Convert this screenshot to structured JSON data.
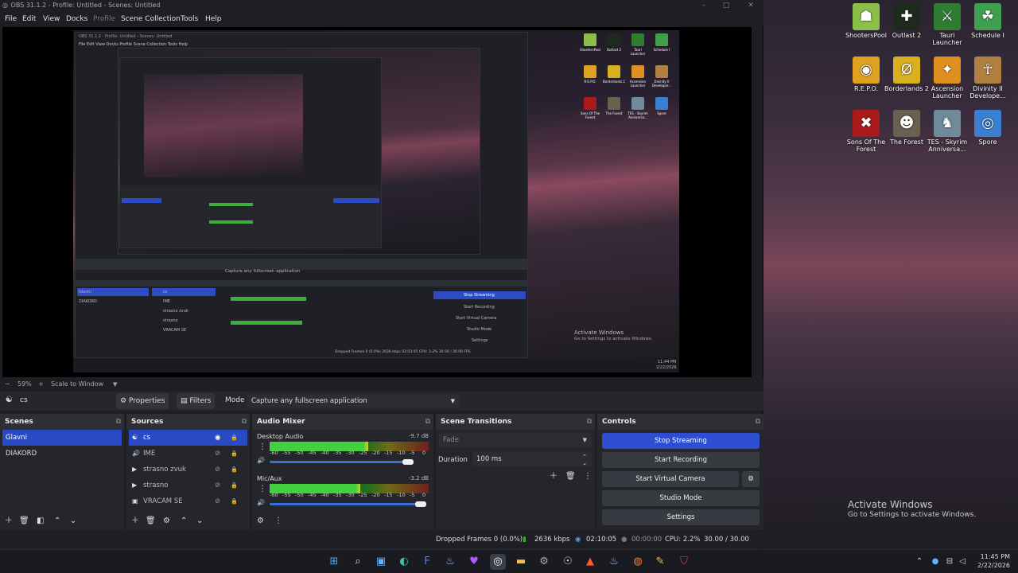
{
  "window": {
    "title": "OBS 31.1.2 - Profile: Untitled - Scenes: Untitled",
    "minimize": "–",
    "maximize": "□",
    "close": "✕"
  },
  "menu": {
    "items": [
      {
        "label": "File",
        "disabled": false
      },
      {
        "label": "Edit",
        "disabled": false
      },
      {
        "label": "View",
        "disabled": false
      },
      {
        "label": "Docks",
        "disabled": false
      },
      {
        "label": "Profile",
        "disabled": true
      },
      {
        "label": "Scene Collection",
        "disabled": false
      },
      {
        "label": "Tools",
        "disabled": false
      },
      {
        "label": "Help",
        "disabled": false
      }
    ]
  },
  "preview": {
    "nested_title": "OBS 31.1.2 - Profile: Untitled - Scenes: Untitled",
    "nested_menu": "File  Edit  View  Docks  Profile  Scene Collection  Tools  Help",
    "nested_scenes": [
      "Glavni",
      "DIAKORD"
    ],
    "nested_sources": [
      "cs",
      "IME",
      "strasno zvuk",
      "strasno",
      "VRACAM SE"
    ],
    "nested_mode": "Capture any fullscreen application",
    "nested_controls": [
      "Stop Streaming",
      "Start Recording",
      "Start Virtual Camera",
      "Studio Mode",
      "Settings"
    ],
    "nested_status": "Dropped Frames 0 (0.0%)   2636 kbps   02:03:05   CPU: 3.2%  30.00 / 30.00 FPS",
    "nested_desktop_icons": [
      "ShootersPool",
      "Outlast 2",
      "Tauri Launcher",
      "Schedule I",
      "R.E.P.O.",
      "Borderlands 2",
      "Ascension Launcher",
      "Divinity II Developer...",
      "Sons Of The Forest",
      "The Forest",
      "TES - Skyrim Anniversa...",
      "Spore"
    ],
    "nested_watermark_title": "Activate Windows",
    "nested_watermark_sub": "Go to Settings to activate Windows.",
    "nested_clock_time": "11:44 PM",
    "nested_clock_date": "2/22/2026"
  },
  "zoom": {
    "value": "59%",
    "mode": "Scale to Window",
    "minus": "−",
    "plus": "+"
  },
  "context": {
    "source": "cs",
    "properties": "Properties",
    "filters": "Filters",
    "mode_label": "Mode",
    "mode_value": "Capture any fullscreen application"
  },
  "scenes": {
    "title": "Scenes",
    "items": [
      {
        "label": "Glavni",
        "selected": true
      },
      {
        "label": "DIAKORD",
        "selected": false
      }
    ]
  },
  "sources": {
    "title": "Sources",
    "items": [
      {
        "label": "cs",
        "selected": true,
        "icon": "game-icon"
      },
      {
        "label": "IME",
        "selected": false,
        "icon": "audio-icon"
      },
      {
        "label": "strasno zvuk",
        "selected": false,
        "icon": "play-icon"
      },
      {
        "label": "strasno",
        "selected": false,
        "icon": "play-icon"
      },
      {
        "label": "VRACAM SE",
        "selected": false,
        "icon": "image-icon"
      }
    ]
  },
  "mixer": {
    "title": "Audio Mixer",
    "channels": [
      {
        "name": "Desktop Audio",
        "db": "-9.7 dB",
        "level": 0.62,
        "volume": 0.87
      },
      {
        "name": "Mic/Aux",
        "db": "-3.2 dB",
        "level": 0.57,
        "volume": 0.95
      }
    ],
    "scale": [
      "-60",
      "-55",
      "-50",
      "-45",
      "-40",
      "-35",
      "-30",
      "-25",
      "-20",
      "-15",
      "-10",
      "-5",
      "0"
    ]
  },
  "transitions": {
    "title": "Scene Transitions",
    "type": "Fade",
    "duration_label": "Duration",
    "duration_value": "100 ms"
  },
  "controls": {
    "title": "Controls",
    "buttons": [
      {
        "label": "Stop Streaming",
        "active": true
      },
      {
        "label": "Start Recording",
        "active": false
      },
      {
        "label": "Start Virtual Camera",
        "active": false
      },
      {
        "label": "Studio Mode",
        "active": false
      },
      {
        "label": "Settings",
        "active": false
      }
    ]
  },
  "status": {
    "dropped": "Dropped Frames 0 (0.0%)",
    "bitrate": "2636 kbps",
    "stream_time": "02:10:05",
    "rec_time": "00:00:00",
    "cpu": "CPU: 2.2%",
    "fps": "30.00 / 30.00 FPS"
  },
  "desktop": {
    "icons": [
      {
        "label": "ShootersPool",
        "color": "#8ac048",
        "glyph": "☗"
      },
      {
        "label": "Outlast 2",
        "color": "#1d2a1d",
        "glyph": "✚"
      },
      {
        "label": "Tauri Launcher",
        "color": "#2e7d32",
        "glyph": "⚔"
      },
      {
        "label": "Schedule I",
        "color": "#3f9f4f",
        "glyph": "☘"
      },
      {
        "label": "R.E.P.O.",
        "color": "#e0a020",
        "glyph": "◉"
      },
      {
        "label": "Borderlands 2",
        "color": "#d8b020",
        "glyph": "Ø"
      },
      {
        "label": "Ascension Launcher",
        "color": "#e09020",
        "glyph": "✦"
      },
      {
        "label": "Divinity II Develope...",
        "color": "#b08040",
        "glyph": "☥"
      },
      {
        "label": "Sons Of The Forest",
        "color": "#aa1a1a",
        "glyph": "✖"
      },
      {
        "label": "The Forest",
        "color": "#6a6050",
        "glyph": "☻"
      },
      {
        "label": "TES - Skyrim Anniversa...",
        "color": "#6f8a9a",
        "glyph": "♞"
      },
      {
        "label": "Spore",
        "color": "#3a7fd0",
        "glyph": "◎"
      }
    ]
  },
  "watermark": {
    "title": "Activate Windows",
    "sub": "Go to Settings to activate Windows."
  },
  "taskbar": {
    "time": "11:45 PM",
    "date": "2/22/2026"
  }
}
